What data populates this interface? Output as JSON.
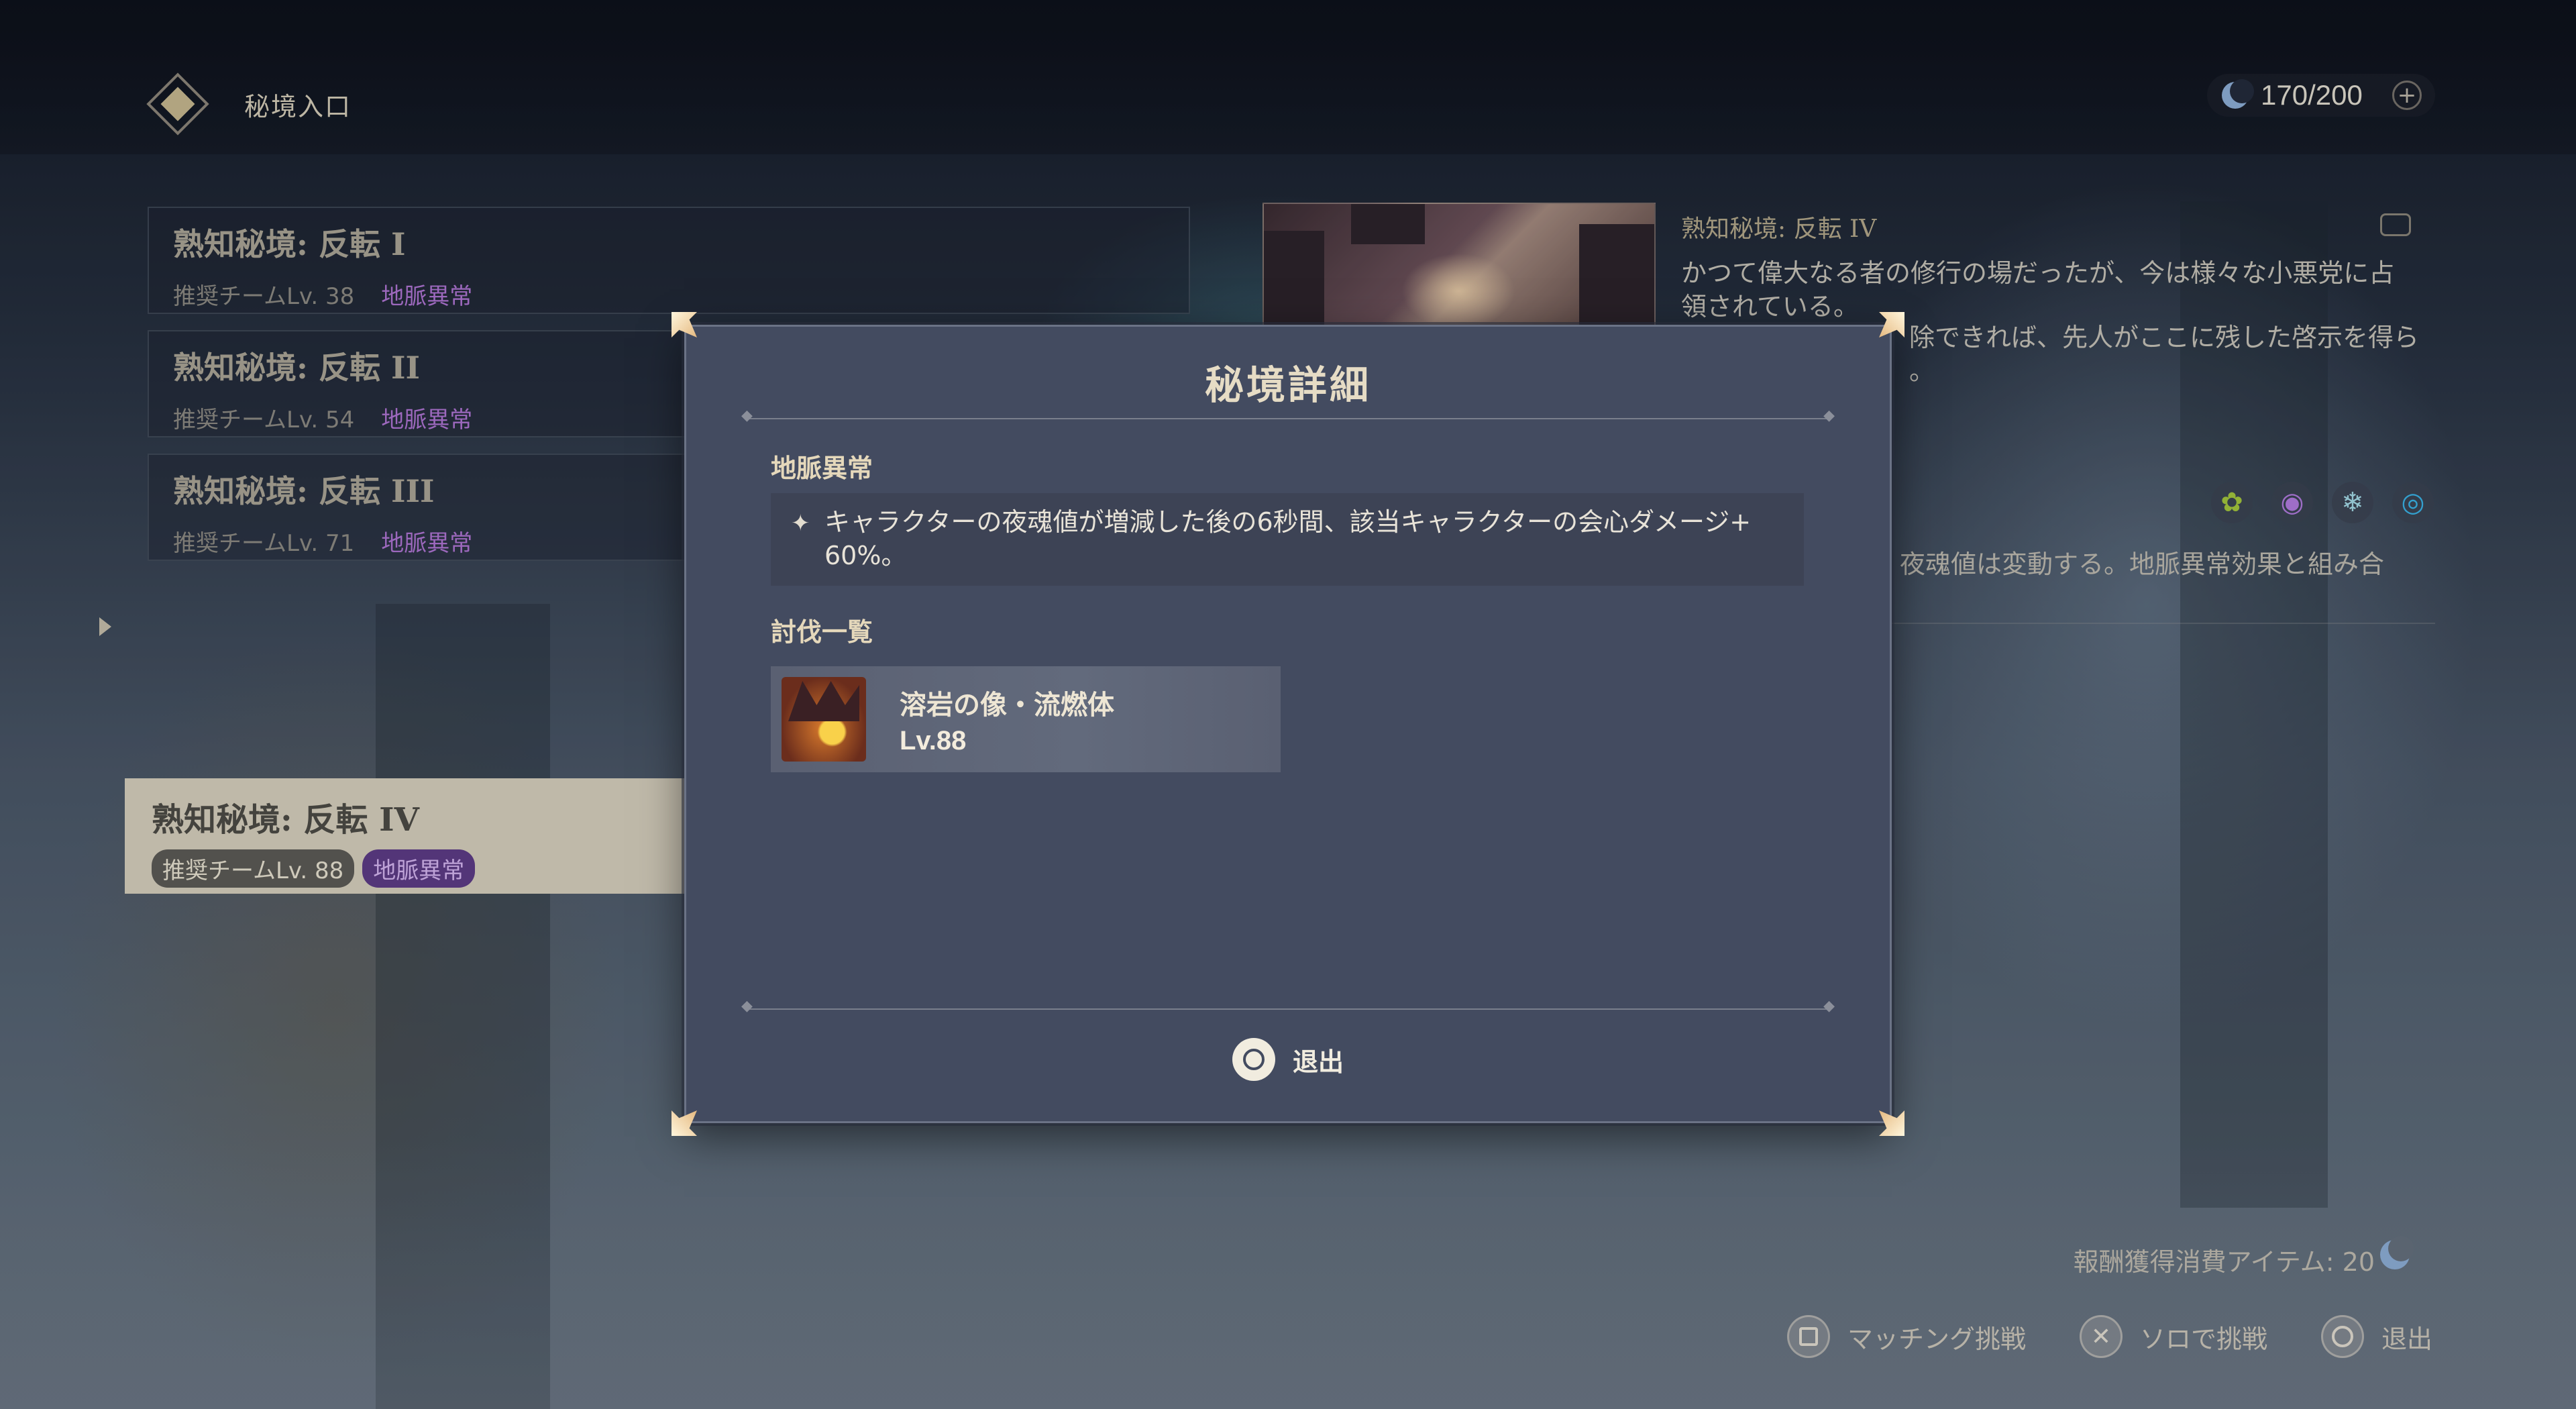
{
  "header": {
    "title": "秘境入口",
    "resin": "170/200"
  },
  "domains": [
    {
      "name": "熟知秘境: 反転 I",
      "level": "推奨チームLv. 38",
      "tag": "地脈異常"
    },
    {
      "name": "熟知秘境: 反転 II",
      "level": "推奨チームLv. 54",
      "tag": "地脈異常"
    },
    {
      "name": "熟知秘境: 反転 III",
      "level": "推奨チームLv. 71",
      "tag": "地脈異常"
    },
    {
      "name": "熟知秘境: 反転 IV",
      "level": "推奨チームLv. 88",
      "tag": "地脈異常"
    }
  ],
  "detail": {
    "title": "熟知秘境: 反転 IV",
    "desc_line1": "かつて偉大なる者の修行の場だったが、今は様々な小悪党に占",
    "desc_line2": "領されている。",
    "desc_line3": "除できれば、先人がここに残した啓示を得ら",
    "desc_line4": "。",
    "ley_desc": "夜魂値は変動する。地脈異常効果と組み合",
    "elements": [
      "dendro",
      "electro",
      "cryo",
      "hydro"
    ],
    "reward_cost": "報酬獲得消費アイテム: 20"
  },
  "hints": {
    "matching": "マッチング挑戦",
    "solo": "ソロで挑戦",
    "exit": "退出"
  },
  "modal": {
    "title": "秘境詳細",
    "ley_title": "地脈異常",
    "ley_text_line1": "キャラクターの夜魂値が増減した後の6秒間、該当キャラクターの会心ダメージ+",
    "ley_text_line2": "60%。",
    "enemy_title": "討伐一覧",
    "enemy_name": "溶岩の像・流燃体",
    "enemy_level": "Lv.88",
    "exit_label": "退出"
  }
}
